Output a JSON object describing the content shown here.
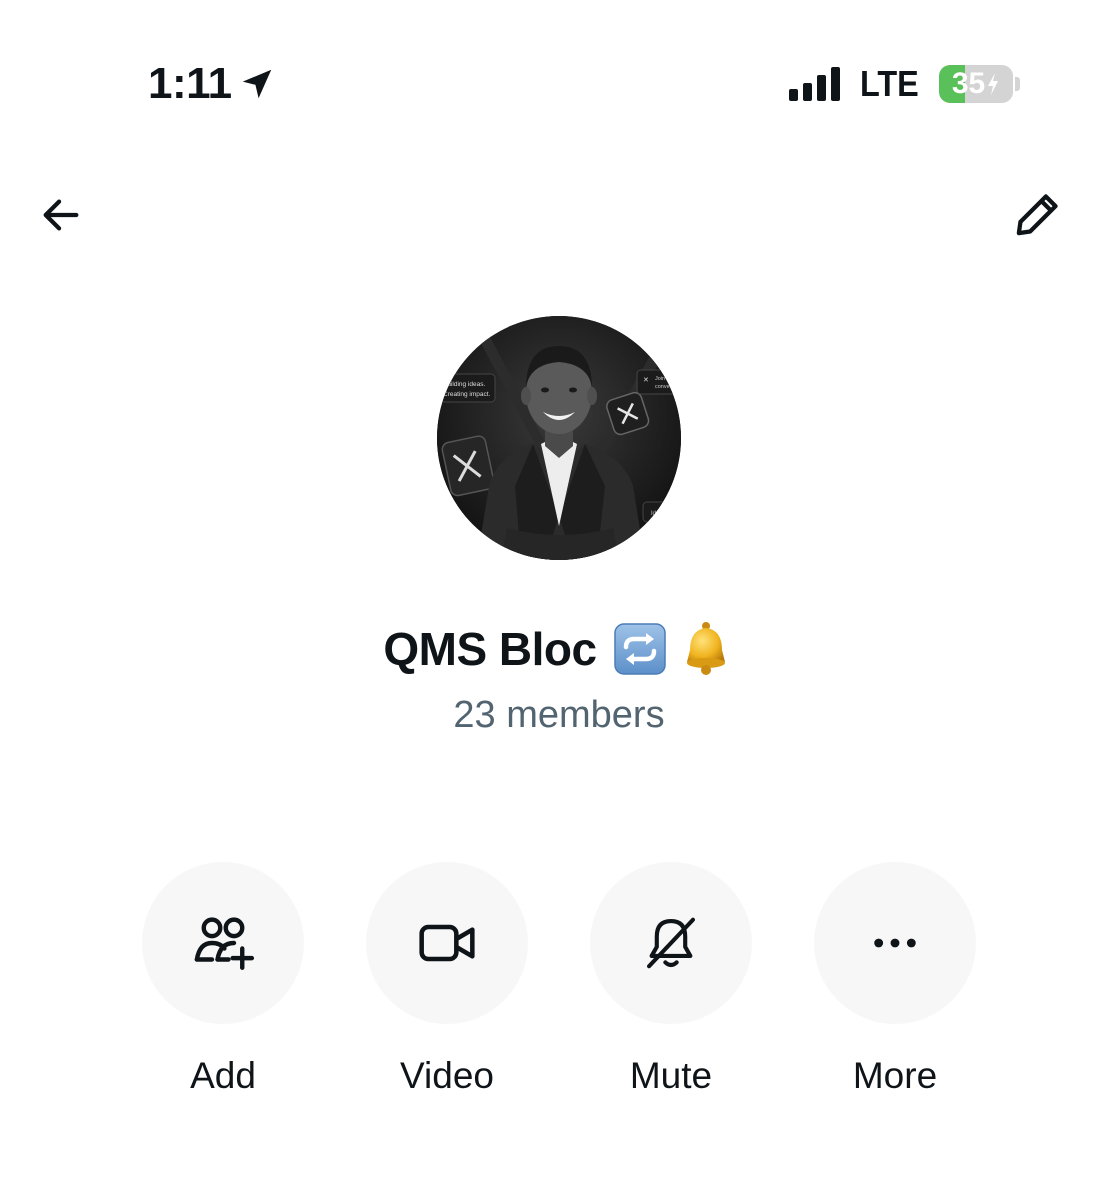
{
  "status_bar": {
    "time": "1:11",
    "network": "LTE",
    "battery_percent": "35",
    "battery_level": 0.35,
    "signal_bars": 4,
    "icons": [
      "location-arrow-icon",
      "signal-icon",
      "battery-charging-icon"
    ]
  },
  "header": {
    "back_icon": "arrow-left-icon",
    "edit_icon": "pencil-icon"
  },
  "group": {
    "name": "QMS Bloc",
    "emojis": [
      "🔁",
      "🔔"
    ],
    "members": "23 members",
    "avatar_texts": [
      "Building ideas.",
      "Creating impact.",
      "Join",
      "conve",
      "Ide"
    ]
  },
  "actions": [
    {
      "label": "Add",
      "icon": "add-people-icon"
    },
    {
      "label": "Video",
      "icon": "video-camera-icon"
    },
    {
      "label": "Mute",
      "icon": "bell-slash-icon"
    },
    {
      "label": "More",
      "icon": "ellipsis-icon"
    }
  ],
  "colors": {
    "text": "#0f1419",
    "secondary": "#536471",
    "action_bg": "#f7f7f7",
    "battery_green": "#5ac05a"
  }
}
